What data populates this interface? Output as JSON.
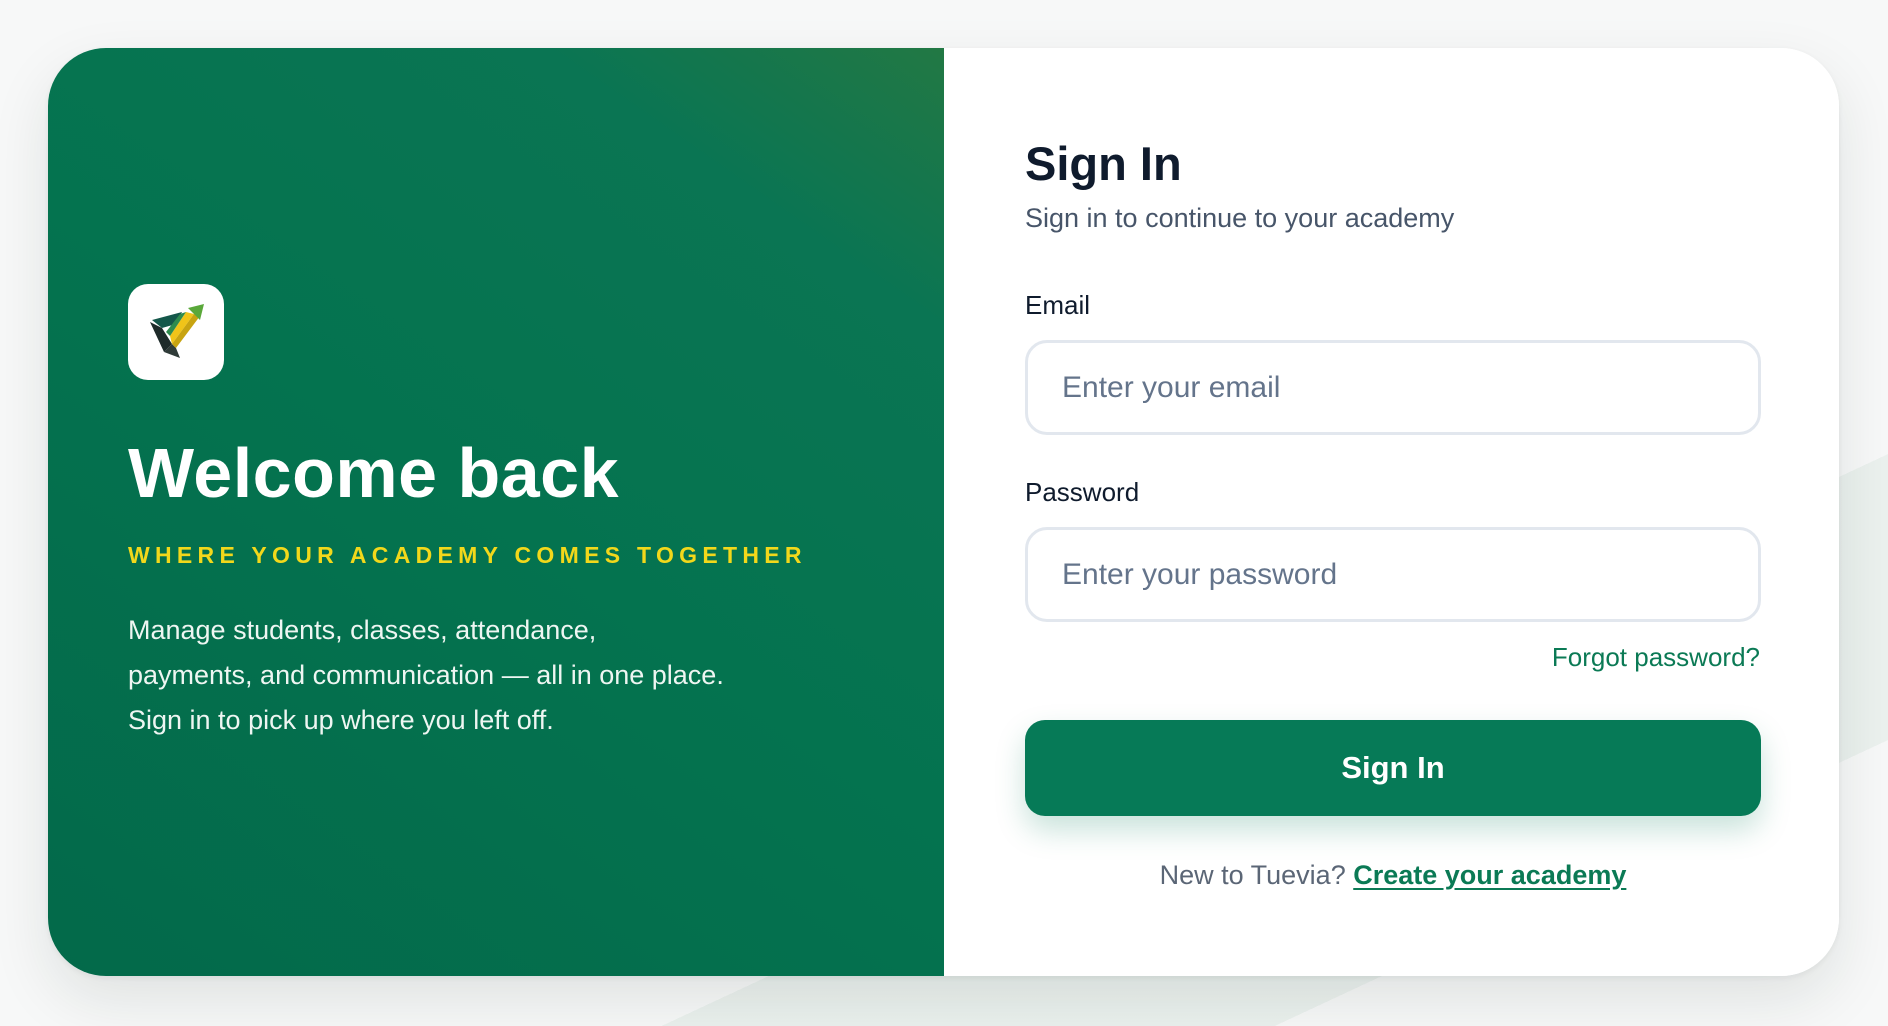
{
  "brand": {
    "logo_icon": "tuevia-logo-icon",
    "accent_color": "#067a57",
    "tagline_color": "#f2d81b"
  },
  "hero": {
    "title": "Welcome back",
    "tagline": "WHERE YOUR ACADEMY COMES TOGETHER",
    "description_lines": [
      "Manage students, classes, attendance,",
      "payments, and communication — all in one place.",
      "Sign in to pick up where you left off."
    ]
  },
  "form": {
    "title": "Sign In",
    "subtitle": "Sign in to continue to your academy",
    "email": {
      "label": "Email",
      "value": "",
      "placeholder": "Enter your email"
    },
    "password": {
      "label": "Password",
      "value": "",
      "placeholder": "Enter your password"
    },
    "forgot_label": "Forgot password?",
    "submit_label": "Sign In",
    "signup_prompt": "New to Tuevia?",
    "signup_link": "Create your academy"
  }
}
